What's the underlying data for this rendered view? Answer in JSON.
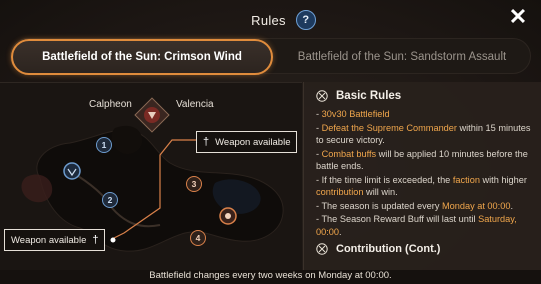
{
  "header": {
    "title": "Rules",
    "help_glyph": "?",
    "close_glyph": "✕"
  },
  "tabs": [
    {
      "label": "Battlefield of the Sun: Crimson Wind",
      "active": true
    },
    {
      "label": "Battlefield of the Sun: Sandstorm Assault",
      "active": false
    }
  ],
  "map": {
    "factions": {
      "left": "Calpheon",
      "right": "Valencia"
    },
    "weapon_top": "Weapon available",
    "weapon_bottom": "Weapon available",
    "points": [
      "1",
      "2",
      "3",
      "4"
    ]
  },
  "rules": {
    "heading": "Basic Rules",
    "items": [
      {
        "parts": [
          {
            "t": "- ",
            "h": false
          },
          {
            "t": "30v30 Battlefield",
            "h": true
          }
        ]
      },
      {
        "parts": [
          {
            "t": "- ",
            "h": false
          },
          {
            "t": "Defeat the Supreme Commander",
            "h": true
          },
          {
            "t": " within 15 minutes to secure victory.",
            "h": false
          }
        ]
      },
      {
        "parts": [
          {
            "t": "- ",
            "h": false
          },
          {
            "t": "Combat buffs",
            "h": true
          },
          {
            "t": " will be applied 10 minutes before the battle ends.",
            "h": false
          }
        ]
      },
      {
        "parts": [
          {
            "t": "- If the time limit is exceeded, the ",
            "h": false
          },
          {
            "t": "faction",
            "h": true
          },
          {
            "t": " with higher ",
            "h": false
          },
          {
            "t": "contribution",
            "h": true
          },
          {
            "t": " will win.",
            "h": false
          }
        ]
      },
      {
        "parts": [
          {
            "t": "- The season is updated every ",
            "h": false
          },
          {
            "t": "Monday at 00:00",
            "h": true
          },
          {
            "t": ".",
            "h": false
          }
        ]
      },
      {
        "parts": [
          {
            "t": "- The Season Reward Buff will last until ",
            "h": false
          },
          {
            "t": "Saturday, 00:00",
            "h": true
          },
          {
            "t": ".",
            "h": false
          }
        ]
      }
    ],
    "section2": "Contribution (Cont.)"
  },
  "footer": "Battlefield changes every two weeks on Monday at 00:00.",
  "colors": {
    "accent": "#e08c3c",
    "highlight": "#f0a64c",
    "blue": "#6d9ccf"
  }
}
